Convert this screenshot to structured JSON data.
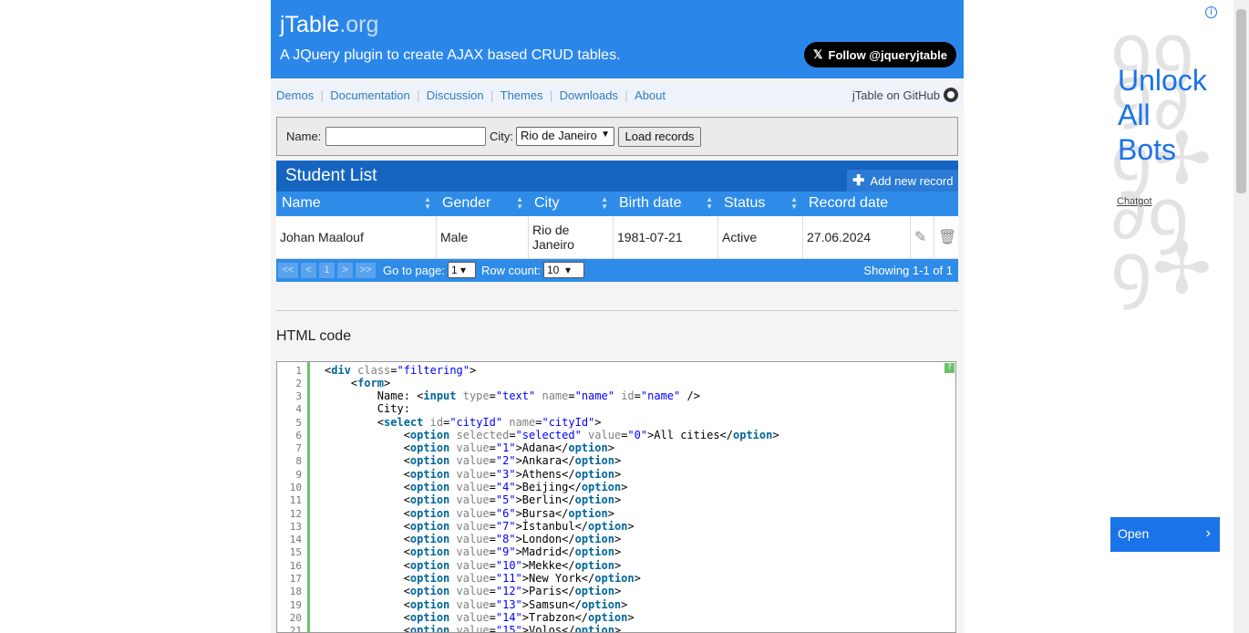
{
  "header": {
    "title_main": "jTable",
    "title_dot": ".org",
    "subtitle": "A JQuery plugin to create AJAX based CRUD tables.",
    "follow": "Follow @jqueryjtable"
  },
  "nav": {
    "items": [
      "Demos",
      "Documentation",
      "Discussion",
      "Themes",
      "Downloads",
      "About"
    ],
    "github": "jTable on GitHub"
  },
  "filter": {
    "name_label": "Name:",
    "name_value": "",
    "city_label": "City:",
    "city_value": "Rio de Janeiro",
    "load": "Load records"
  },
  "table": {
    "title": "Student List",
    "add": "Add new record",
    "columns": [
      "Name",
      "Gender",
      "City",
      "Birth date",
      "Status",
      "Record date"
    ],
    "rows": [
      [
        "Johan Maalouf",
        "Male",
        "Rio de Janeiro",
        "1981-07-21",
        "Active",
        "27.06.2024"
      ]
    ],
    "footer": {
      "first": "<<",
      "prev": "<",
      "page": "1",
      "next": ">",
      "last": ">>",
      "goto": "Go to page:",
      "goto_value": "1",
      "rowcount": "Row count:",
      "rowcount_value": "10",
      "showing": "Showing 1-1 of 1"
    }
  },
  "code": {
    "title": "HTML code",
    "help": "?"
  },
  "ad": {
    "headline_1": "Unlock",
    "headline_2": "All",
    "headline_3": "Bots",
    "brand": "Chatgot",
    "open": "Open",
    "info": "i"
  }
}
